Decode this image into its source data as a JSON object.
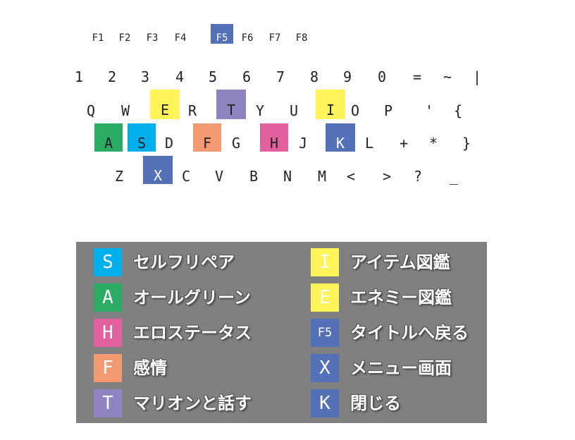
{
  "colors": {
    "blue": "#00b0ec",
    "green": "#2bab63",
    "pink": "#e2609e",
    "orange": "#f39a72",
    "purple": "#8f83c0",
    "yellow": "#fff35a",
    "navy": "#5470b6",
    "panel": "#808080"
  },
  "function_keys": [
    "F1",
    "F2",
    "F3",
    "F4",
    "F5",
    "F6",
    "F7",
    "F8"
  ],
  "keyboard_rows": [
    [
      "1",
      "2",
      "3",
      "4",
      "5",
      "6",
      "7",
      "8",
      "9",
      "0",
      "=",
      "~",
      "|"
    ],
    [
      "Q",
      "W",
      "E",
      "R",
      "T",
      "Y",
      "U",
      "I",
      "O",
      "P",
      "'",
      "{"
    ],
    [
      "A",
      "S",
      "D",
      "F",
      "G",
      "H",
      "J",
      "K",
      "L",
      "+",
      "*",
      "}"
    ],
    [
      "Z",
      "X",
      "C",
      "V",
      "B",
      "N",
      "M",
      "<",
      ">",
      "?",
      "_"
    ]
  ],
  "legend": {
    "left": [
      {
        "key": "S",
        "label": "セルフリペア"
      },
      {
        "key": "A",
        "label": "オールグリーン"
      },
      {
        "key": "H",
        "label": "エロステータス"
      },
      {
        "key": "F",
        "label": "感情"
      },
      {
        "key": "T",
        "label": "マリオンと話す"
      }
    ],
    "right": [
      {
        "key": "I",
        "label": "アイテム図鑑"
      },
      {
        "key": "E",
        "label": "エネミー図鑑"
      },
      {
        "key": "F5",
        "label": "タイトルへ戻る"
      },
      {
        "key": "X",
        "label": "メニュー画面"
      },
      {
        "key": "K",
        "label": "閉じる"
      }
    ]
  }
}
